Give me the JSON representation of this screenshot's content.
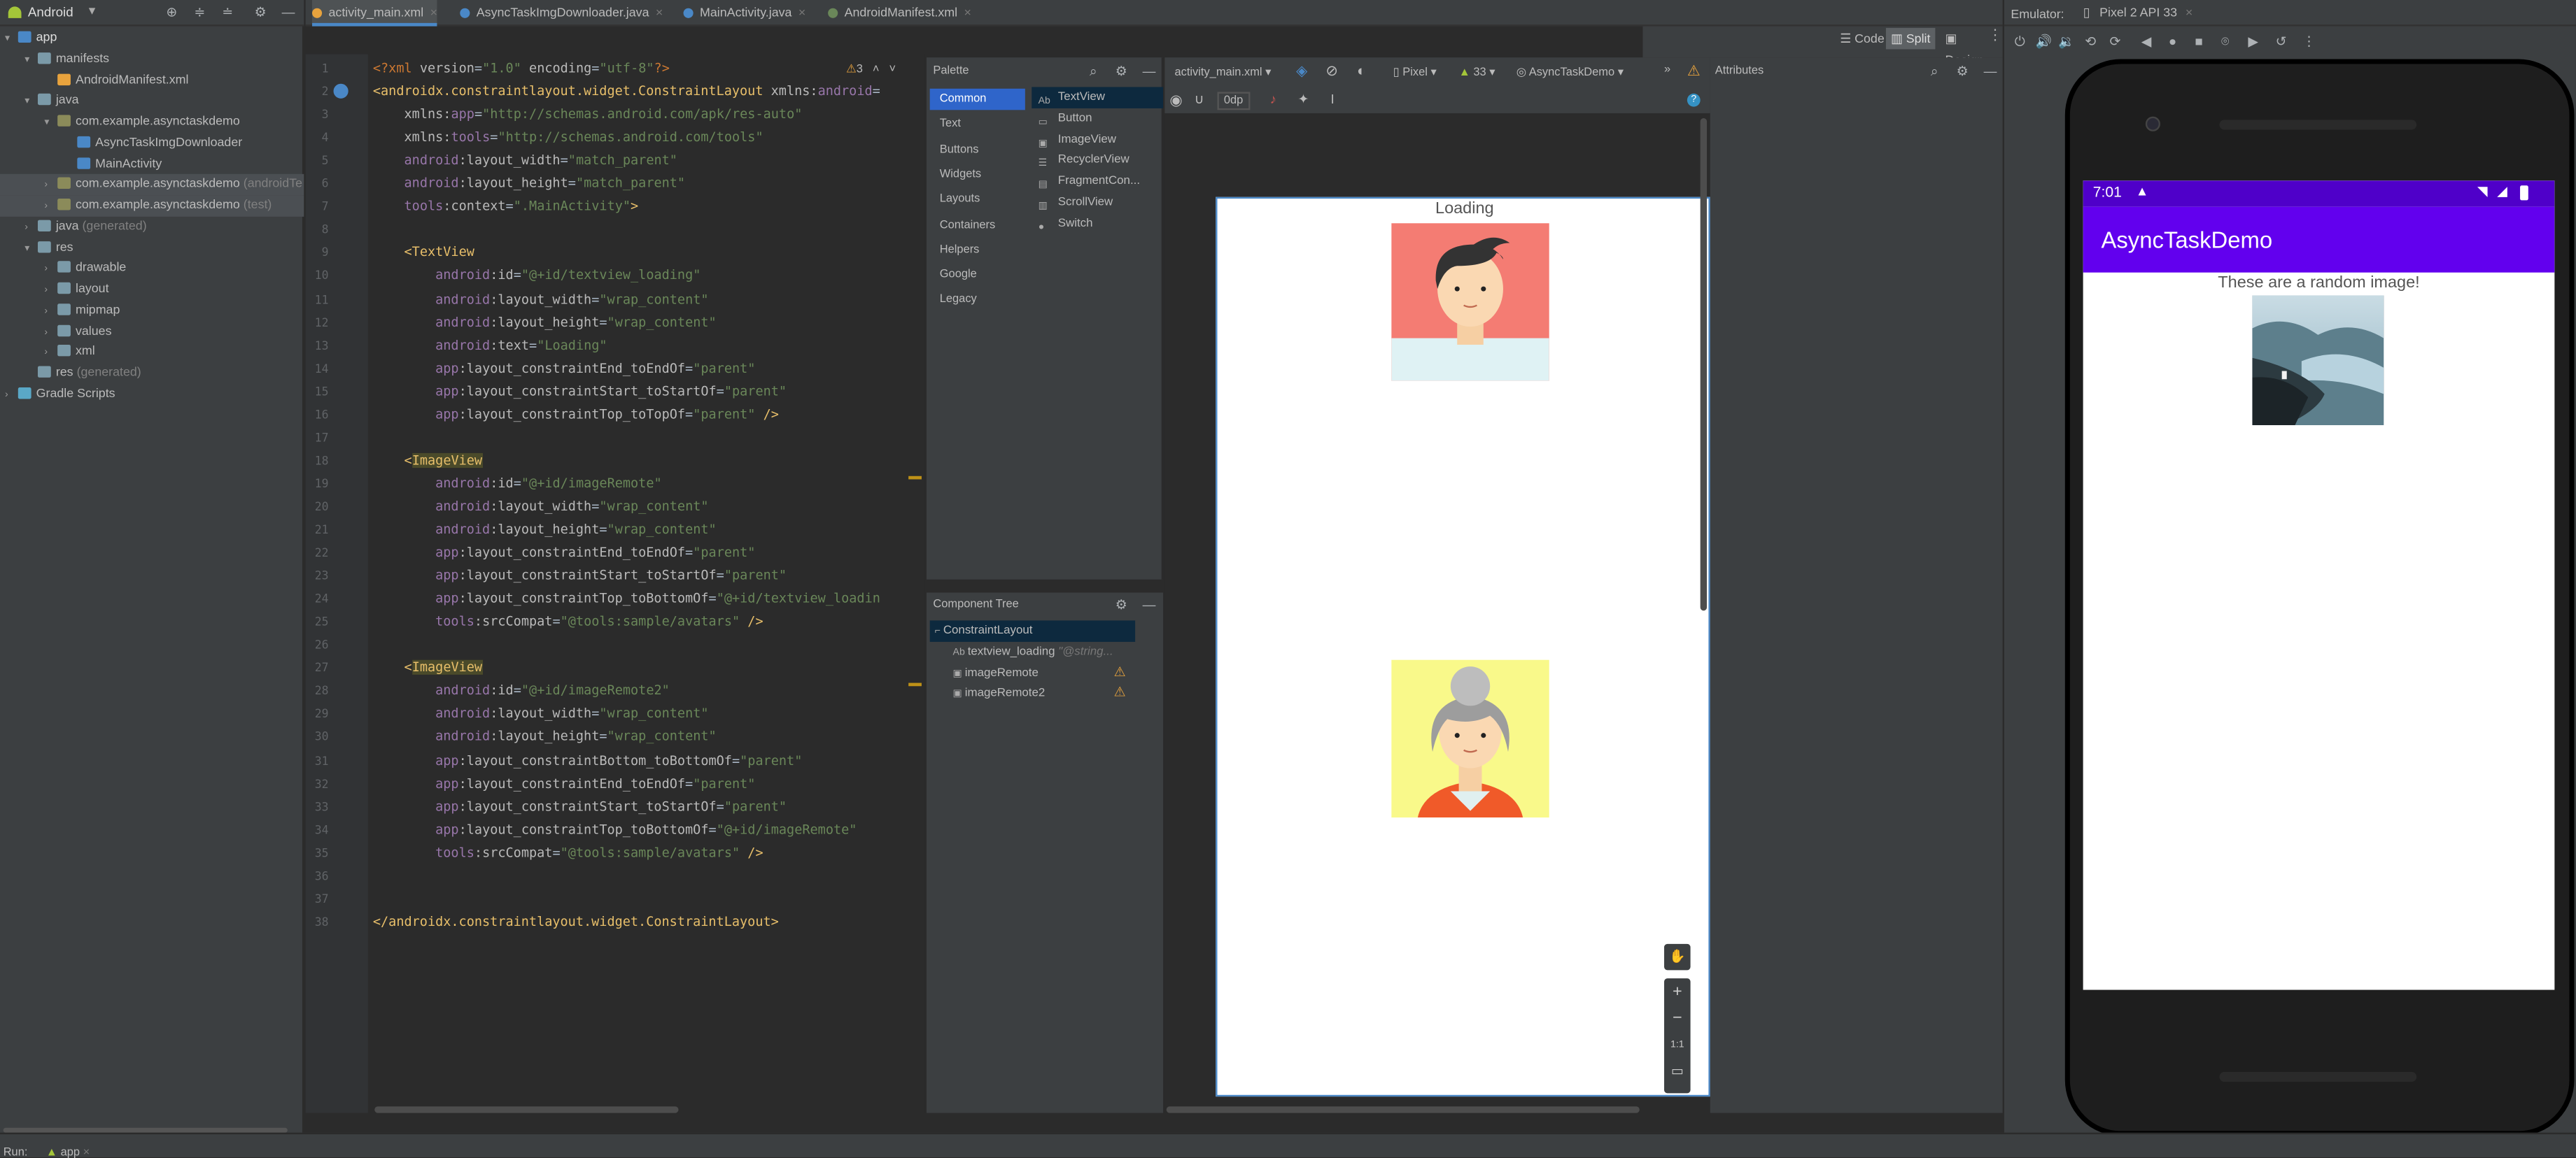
{
  "project": {
    "view_label": "Android",
    "tree": [
      {
        "label": "app",
        "depth": 0,
        "arrow": "▾",
        "icon": "module",
        "bold": true
      },
      {
        "label": "manifests",
        "depth": 1,
        "arrow": "▾",
        "icon": "folder"
      },
      {
        "label": "AndroidManifest.xml",
        "depth": 2,
        "arrow": "",
        "icon": "xml"
      },
      {
        "label": "java",
        "depth": 1,
        "arrow": "▾",
        "icon": "folder"
      },
      {
        "label": "com.example.asynctaskdemo",
        "depth": 2,
        "arrow": "▾",
        "icon": "package"
      },
      {
        "label": "AsyncTaskImgDownloader",
        "depth": 3,
        "arrow": "",
        "icon": "class"
      },
      {
        "label": "MainActivity",
        "depth": 3,
        "arrow": "",
        "icon": "class"
      },
      {
        "label": "com.example.asynctaskdemo",
        "suffix": "(androidTe",
        "depth": 2,
        "arrow": "›",
        "icon": "package",
        "sel": true
      },
      {
        "label": "com.example.asynctaskdemo",
        "suffix": "(test)",
        "depth": 2,
        "arrow": "›",
        "icon": "package",
        "sel": true
      },
      {
        "label": "java",
        "suffix": "(generated)",
        "depth": 1,
        "arrow": "›",
        "icon": "folder"
      },
      {
        "label": "res",
        "depth": 1,
        "arrow": "▾",
        "icon": "folder"
      },
      {
        "label": "drawable",
        "depth": 2,
        "arrow": "›",
        "icon": "folder"
      },
      {
        "label": "layout",
        "depth": 2,
        "arrow": "›",
        "icon": "folder"
      },
      {
        "label": "mipmap",
        "depth": 2,
        "arrow": "›",
        "icon": "folder"
      },
      {
        "label": "values",
        "depth": 2,
        "arrow": "›",
        "icon": "folder"
      },
      {
        "label": "xml",
        "depth": 2,
        "arrow": "›",
        "icon": "folder"
      },
      {
        "label": "res",
        "suffix": "(generated)",
        "depth": 1,
        "arrow": "",
        "icon": "folder"
      },
      {
        "label": "Gradle Scripts",
        "depth": 0,
        "arrow": "›",
        "icon": "gradle"
      }
    ]
  },
  "tabs": [
    {
      "label": "activity_main.xml",
      "active": true,
      "color": "#e8a33d"
    },
    {
      "label": "AsyncTaskImgDownloader.java",
      "active": false,
      "color": "#4a88c7"
    },
    {
      "label": "MainActivity.java",
      "active": false,
      "color": "#4a88c7"
    },
    {
      "label": "AndroidManifest.xml",
      "active": false,
      "color": "#6a8759"
    }
  ],
  "mode_bar": {
    "code": "Code",
    "split": "Split",
    "design": "Design"
  },
  "editor": {
    "warning_count": "3",
    "lines": [
      [
        [
          "pi",
          "<?xml "
        ],
        [
          "at",
          "version"
        ],
        [
          "",
          "="
        ],
        [
          "str",
          "\"1.0\""
        ],
        [
          "at",
          " encoding"
        ],
        [
          "",
          "="
        ],
        [
          "str",
          "\"utf-8\""
        ],
        [
          "pi",
          "?>"
        ]
      ],
      [
        [
          "tag",
          "<androidx.constraintlayout.widget.ConstraintLayout "
        ],
        [
          "at",
          "xmlns:"
        ],
        [
          "ns",
          "android"
        ],
        [
          "",
          "="
        ]
      ],
      [
        [
          "",
          "    "
        ],
        [
          "at",
          "xmlns:"
        ],
        [
          "ns",
          "app"
        ],
        [
          "",
          "="
        ],
        [
          "str",
          "\"http://schemas.android.com/apk/res-auto\""
        ]
      ],
      [
        [
          "",
          "    "
        ],
        [
          "at",
          "xmlns:"
        ],
        [
          "ns",
          "tools"
        ],
        [
          "",
          "="
        ],
        [
          "str",
          "\"http://schemas.android.com/tools\""
        ]
      ],
      [
        [
          "",
          "    "
        ],
        [
          "ns",
          "android"
        ],
        [
          "at",
          ":layout_width"
        ],
        [
          "",
          "="
        ],
        [
          "str",
          "\"match_parent\""
        ]
      ],
      [
        [
          "",
          "    "
        ],
        [
          "ns",
          "android"
        ],
        [
          "at",
          ":layout_height"
        ],
        [
          "",
          "="
        ],
        [
          "str",
          "\"match_parent\""
        ]
      ],
      [
        [
          "",
          "    "
        ],
        [
          "ns",
          "tools"
        ],
        [
          "at",
          ":context"
        ],
        [
          "",
          "="
        ],
        [
          "str",
          "\".MainActivity\""
        ],
        [
          "tag",
          ">"
        ]
      ],
      [
        [
          "",
          ""
        ]
      ],
      [
        [
          "",
          "    "
        ],
        [
          "tag",
          "<TextView"
        ]
      ],
      [
        [
          "",
          "        "
        ],
        [
          "ns",
          "android"
        ],
        [
          "at",
          ":id"
        ],
        [
          "",
          "="
        ],
        [
          "str",
          "\"@+id/textview_loading\""
        ]
      ],
      [
        [
          "",
          "        "
        ],
        [
          "ns",
          "android"
        ],
        [
          "at",
          ":layout_width"
        ],
        [
          "",
          "="
        ],
        [
          "str",
          "\"wrap_content\""
        ]
      ],
      [
        [
          "",
          "        "
        ],
        [
          "ns",
          "android"
        ],
        [
          "at",
          ":layout_height"
        ],
        [
          "",
          "="
        ],
        [
          "str",
          "\"wrap_content\""
        ]
      ],
      [
        [
          "",
          "        "
        ],
        [
          "ns",
          "android"
        ],
        [
          "at",
          ":text"
        ],
        [
          "",
          "="
        ],
        [
          "str",
          "\"Loading\""
        ]
      ],
      [
        [
          "",
          "        "
        ],
        [
          "ns",
          "app"
        ],
        [
          "at",
          ":layout_constraintEnd_toEndOf"
        ],
        [
          "",
          "="
        ],
        [
          "str",
          "\"parent\""
        ]
      ],
      [
        [
          "",
          "        "
        ],
        [
          "ns",
          "app"
        ],
        [
          "at",
          ":layout_constraintStart_toStartOf"
        ],
        [
          "",
          "="
        ],
        [
          "str",
          "\"parent\""
        ]
      ],
      [
        [
          "",
          "        "
        ],
        [
          "ns",
          "app"
        ],
        [
          "at",
          ":layout_constraintTop_toTopOf"
        ],
        [
          "",
          "="
        ],
        [
          "str",
          "\"parent\""
        ],
        [
          "tag",
          " />"
        ]
      ],
      [
        [
          "",
          ""
        ]
      ],
      [
        [
          "",
          "    "
        ],
        [
          "tag",
          "<"
        ],
        [
          "hl",
          "ImageView"
        ]
      ],
      [
        [
          "",
          "        "
        ],
        [
          "ns",
          "android"
        ],
        [
          "at",
          ":id"
        ],
        [
          "",
          "="
        ],
        [
          "str",
          "\"@+id/imageRemote\""
        ]
      ],
      [
        [
          "",
          "        "
        ],
        [
          "ns",
          "android"
        ],
        [
          "at",
          ":layout_width"
        ],
        [
          "",
          "="
        ],
        [
          "str",
          "\"wrap_content\""
        ]
      ],
      [
        [
          "",
          "        "
        ],
        [
          "ns",
          "android"
        ],
        [
          "at",
          ":layout_height"
        ],
        [
          "",
          "="
        ],
        [
          "str",
          "\"wrap_content\""
        ]
      ],
      [
        [
          "",
          "        "
        ],
        [
          "ns",
          "app"
        ],
        [
          "at",
          ":layout_constraintEnd_toEndOf"
        ],
        [
          "",
          "="
        ],
        [
          "str",
          "\"parent\""
        ]
      ],
      [
        [
          "",
          "        "
        ],
        [
          "ns",
          "app"
        ],
        [
          "at",
          ":layout_constraintStart_toStartOf"
        ],
        [
          "",
          "="
        ],
        [
          "str",
          "\"parent\""
        ]
      ],
      [
        [
          "",
          "        "
        ],
        [
          "ns",
          "app"
        ],
        [
          "at",
          ":layout_constraintTop_toBottomOf"
        ],
        [
          "",
          "="
        ],
        [
          "str",
          "\"@+id/textview_loadin"
        ]
      ],
      [
        [
          "",
          "        "
        ],
        [
          "ns",
          "tools"
        ],
        [
          "at",
          ":srcCompat"
        ],
        [
          "",
          "="
        ],
        [
          "str",
          "\"@tools:sample/avatars\""
        ],
        [
          "tag",
          " />"
        ]
      ],
      [
        [
          "",
          ""
        ]
      ],
      [
        [
          "",
          "    "
        ],
        [
          "tag",
          "<"
        ],
        [
          "hl",
          "ImageView"
        ]
      ],
      [
        [
          "",
          "        "
        ],
        [
          "ns",
          "android"
        ],
        [
          "at",
          ":id"
        ],
        [
          "",
          "="
        ],
        [
          "str",
          "\"@+id/imageRemote2\""
        ]
      ],
      [
        [
          "",
          "        "
        ],
        [
          "ns",
          "android"
        ],
        [
          "at",
          ":layout_width"
        ],
        [
          "",
          "="
        ],
        [
          "str",
          "\"wrap_content\""
        ]
      ],
      [
        [
          "",
          "        "
        ],
        [
          "ns",
          "android"
        ],
        [
          "at",
          ":layout_height"
        ],
        [
          "",
          "="
        ],
        [
          "str",
          "\"wrap_content\""
        ]
      ],
      [
        [
          "",
          "        "
        ],
        [
          "ns",
          "app"
        ],
        [
          "at",
          ":layout_constraintBottom_toBottomOf"
        ],
        [
          "",
          "="
        ],
        [
          "str",
          "\"parent\""
        ]
      ],
      [
        [
          "",
          "        "
        ],
        [
          "ns",
          "app"
        ],
        [
          "at",
          ":layout_constraintEnd_toEndOf"
        ],
        [
          "",
          "="
        ],
        [
          "str",
          "\"parent\""
        ]
      ],
      [
        [
          "",
          "        "
        ],
        [
          "ns",
          "app"
        ],
        [
          "at",
          ":layout_constraintStart_toStartOf"
        ],
        [
          "",
          "="
        ],
        [
          "str",
          "\"parent\""
        ]
      ],
      [
        [
          "",
          "        "
        ],
        [
          "ns",
          "app"
        ],
        [
          "at",
          ":layout_constraintTop_toBottomOf"
        ],
        [
          "",
          "="
        ],
        [
          "str",
          "\"@+id/imageRemote\""
        ]
      ],
      [
        [
          "",
          "        "
        ],
        [
          "ns",
          "tools"
        ],
        [
          "at",
          ":srcCompat"
        ],
        [
          "",
          "="
        ],
        [
          "str",
          "\"@tools:sample/avatars\""
        ],
        [
          "tag",
          " />"
        ]
      ],
      [
        [
          "",
          ""
        ]
      ],
      [
        [
          "",
          ""
        ]
      ],
      [
        [
          "tag",
          "</androidx.constraintlayout.widget.ConstraintLayout>"
        ]
      ]
    ]
  },
  "palette": {
    "title": "Palette",
    "categories": [
      "Common",
      "Text",
      "Buttons",
      "Widgets",
      "Layouts",
      "Containers",
      "Helpers",
      "Google",
      "Legacy"
    ],
    "items": [
      {
        "label": "TextView",
        "icon": "Ab"
      },
      {
        "label": "Button",
        "icon": "▭"
      },
      {
        "label": "ImageView",
        "icon": "▣"
      },
      {
        "label": "RecyclerView",
        "icon": "☰"
      },
      {
        "label": "FragmentCon...",
        "icon": "▤"
      },
      {
        "label": "ScrollView",
        "icon": "▥"
      },
      {
        "label": "Switch",
        "icon": "●"
      }
    ]
  },
  "component_tree": {
    "title": "Component Tree",
    "rows": [
      {
        "label": "ConstraintLayout",
        "icon": "⌐",
        "warn": false,
        "hint": ""
      },
      {
        "label": "textview_loading",
        "icon": "Ab",
        "warn": false,
        "hint": "\"@string..."
      },
      {
        "label": "imageRemote",
        "icon": "▣",
        "warn": true,
        "hint": ""
      },
      {
        "label": "imageRemote2",
        "icon": "▣",
        "warn": true,
        "hint": ""
      }
    ]
  },
  "design_toolbar": {
    "file": "activity_main.xml",
    "margin": "0dp",
    "device": "Pixel",
    "api": "33",
    "theme": "AsyncTaskDemo",
    "attributes": "Attributes"
  },
  "design_preview": {
    "loading_text": "Loading",
    "zoom_ratio": "1:1"
  },
  "emulator": {
    "label": "Emulator:",
    "device_tab": "Pixel 2 API 33",
    "time": "7:01",
    "app_title": "AsyncTaskDemo",
    "message": "These are a random image!",
    "colors": {
      "status": "#4f00c9",
      "appbar": "#6200ee"
    }
  },
  "status": {
    "run_label": "Run:",
    "run_config": "app"
  }
}
